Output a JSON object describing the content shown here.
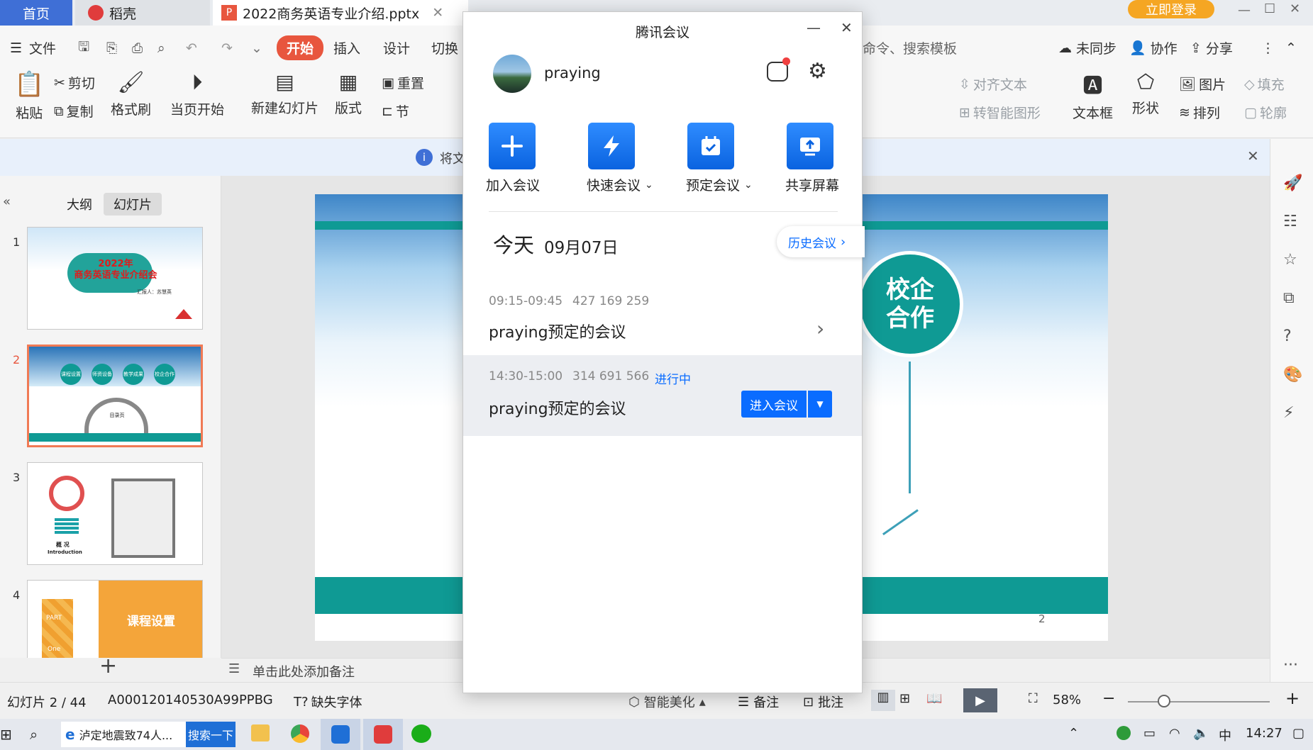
{
  "tabs": {
    "home": "首页",
    "daoke": "稻壳",
    "doc": "2022商务英语专业介绍.pptx",
    "login": "立即登录"
  },
  "menu": {
    "file": "文件",
    "start": "开始",
    "insert": "插入",
    "design": "设计",
    "switch": "切换",
    "search": "命令、搜索模板",
    "unsynced": "未同步",
    "collab": "协作",
    "share": "分享"
  },
  "ribbon": {
    "paste": "粘贴",
    "cut": "剪切",
    "copy": "复制",
    "format_painter": "格式刷",
    "play_current": "当页开始",
    "new_slide": "新建幻灯片",
    "layout": "版式",
    "reset": "重置",
    "section": "节",
    "align_text": "对齐文本",
    "smart_art": "转智能图形",
    "text_box": "文本框",
    "shape": "形状",
    "picture": "图片",
    "arrange": "排列",
    "fill": "填充",
    "outline": "轮廓"
  },
  "notice": {
    "text": "将文"
  },
  "panel": {
    "outline_tab": "大纲",
    "slides_tab": "幻灯片"
  },
  "thumbs": {
    "t1_title1": "2022年",
    "t1_title2": "商务英语专业介绍会",
    "t1_reporter": "汇报人：苏慧英",
    "t2_c1": "课程设置",
    "t2_c2": "师资设备",
    "t2_c3": "教学成果",
    "t2_c4": "校企合作",
    "t2_center": "目录页",
    "t3_label": "概 况",
    "t3_en": "Introduction",
    "t4_part": "PART",
    "t4_one": "One",
    "t4_title": "课程设置"
  },
  "slide": {
    "coop": "校企合作",
    "page": "2"
  },
  "notes": {
    "placeholder": "单击此处添加备注"
  },
  "status": {
    "slide_pos": "幻灯片 2 / 44",
    "doc_id": "A000120140530A99PPBG",
    "missing_font": "缺失字体",
    "beautify": "智能美化",
    "notes": "备注",
    "comment": "批注",
    "zoom": "58%"
  },
  "taskbar": {
    "news": "泸定地震致74人...",
    "search_btn": "搜索一下",
    "ime": "中",
    "time": "14:27"
  },
  "dialog": {
    "title": "腾讯会议",
    "user": "praying",
    "actions": [
      {
        "label": "加入会议"
      },
      {
        "label": "快速会议"
      },
      {
        "label": "预定会议"
      },
      {
        "label": "共享屏幕"
      }
    ],
    "today": "今天",
    "date": "09月07日",
    "history": "历史会议",
    "meetings": [
      {
        "time": "09:15-09:45",
        "id": "427 169 259",
        "title": "praying预定的会议",
        "status": ""
      },
      {
        "time": "14:30-15:00",
        "id": "314 691 566",
        "title": "praying预定的会议",
        "status": "进行中"
      }
    ],
    "join_btn": "进入会议"
  },
  "colors": {
    "accent_blue": "#0a6cff",
    "teal": "#0f9a94",
    "wps_red": "#e8563e"
  }
}
